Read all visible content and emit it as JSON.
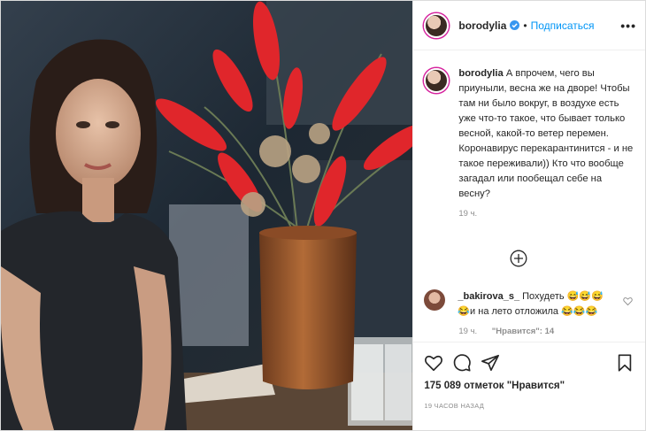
{
  "post": {
    "username": "borodylia",
    "follow_label": "Подписаться",
    "dot": "•",
    "more": "•••"
  },
  "caption": {
    "username": "borodylia",
    "text": "А впрочем, чего вы приуныли, весна же на дворе! Чтобы там ни было вокруг, в воздухе есть уже что-то такое, что бывает только весной, какой-то ветер перемен. Коронавирус перекарантинится - и не такое переживали)) Кто что вообще загадал или пообещал себе на весну?",
    "time": "19 ч."
  },
  "comment": {
    "username": "_bakirova_s_",
    "text": "Похудеть 😅😅😅😂и на лето отложила 😂😂😂",
    "time": "19 ч.",
    "likes": "\"Нравится\": 14"
  },
  "actions": {
    "likes_text": "175 089 отметок \"Нравится\"",
    "post_time": "19 ЧАСОВ НАЗАД"
  },
  "icons": {
    "verified": "verified-badge-icon",
    "more": "more-options-icon",
    "plus": "load-more-comments-icon",
    "comment_heart": "comment-like-icon",
    "heart": "like-icon",
    "comment": "comment-icon",
    "share": "share-icon",
    "save": "save-icon"
  },
  "colors": {
    "accent": "#0095f6",
    "text": "#262626",
    "muted": "#8e8e8e",
    "border": "#efefef"
  }
}
